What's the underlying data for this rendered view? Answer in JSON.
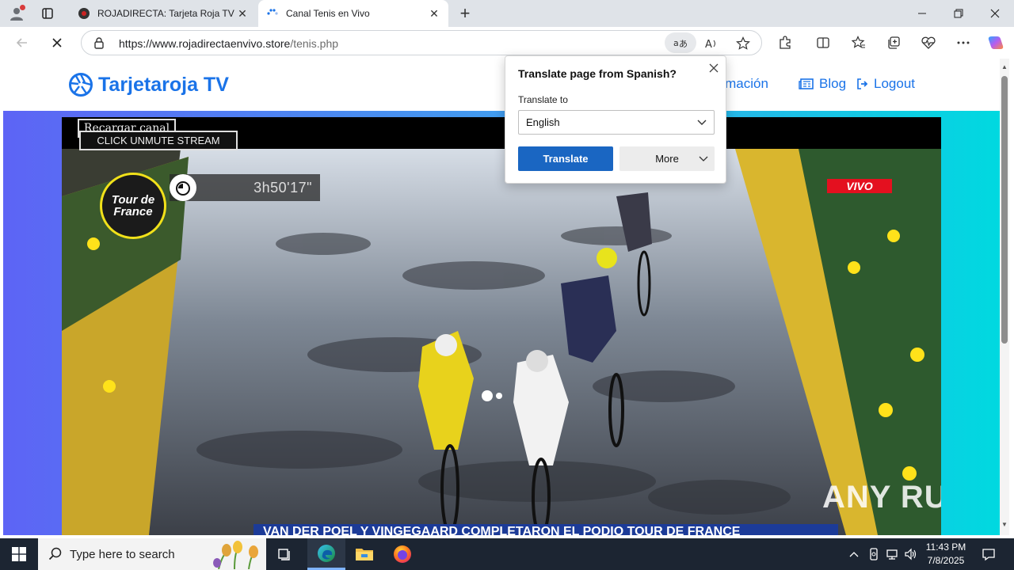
{
  "browser": {
    "tabs": [
      {
        "title": "ROJADIRECTA: Tarjeta Roja TV - Pi",
        "active": false
      },
      {
        "title": "Canal Tenis en Vivo",
        "active": true
      }
    ],
    "address": {
      "url_main": "https://www.rojadirectaenvivo.store",
      "url_path": "/tenis.php"
    }
  },
  "site": {
    "brand": "Tarjetaroja TV",
    "nav": [
      {
        "label": "ramación",
        "icon": "calendar-icon"
      },
      {
        "label": "Blog",
        "icon": "newspaper-icon"
      },
      {
        "label": "Logout",
        "icon": "logout-icon"
      }
    ]
  },
  "player": {
    "reload_label": "Recargar canal",
    "unmute_label": "CLICK UNMUTE STREAM",
    "timer": "3h50'17\"",
    "tdf_logo_text": "Tour de France",
    "live_badge": "VIVO",
    "ticker": "VAN DER POEL Y VINGEGAARD COMPLETARON EL PODIO    TOUR DE FRANCE",
    "watermark": "ANY RUN"
  },
  "translate_popup": {
    "title": "Translate page from Spanish?",
    "label": "Translate to",
    "selected_language": "English",
    "translate_button": "Translate",
    "more_button": "More"
  },
  "taskbar": {
    "search_placeholder": "Type here to search",
    "time": "11:43 PM",
    "date": "7/8/2025"
  },
  "colors": {
    "brand_blue": "#1a73e8",
    "translate_blue": "#1a66c2",
    "live_red": "#e4101f",
    "taskbar_bg": "#1c2532"
  }
}
